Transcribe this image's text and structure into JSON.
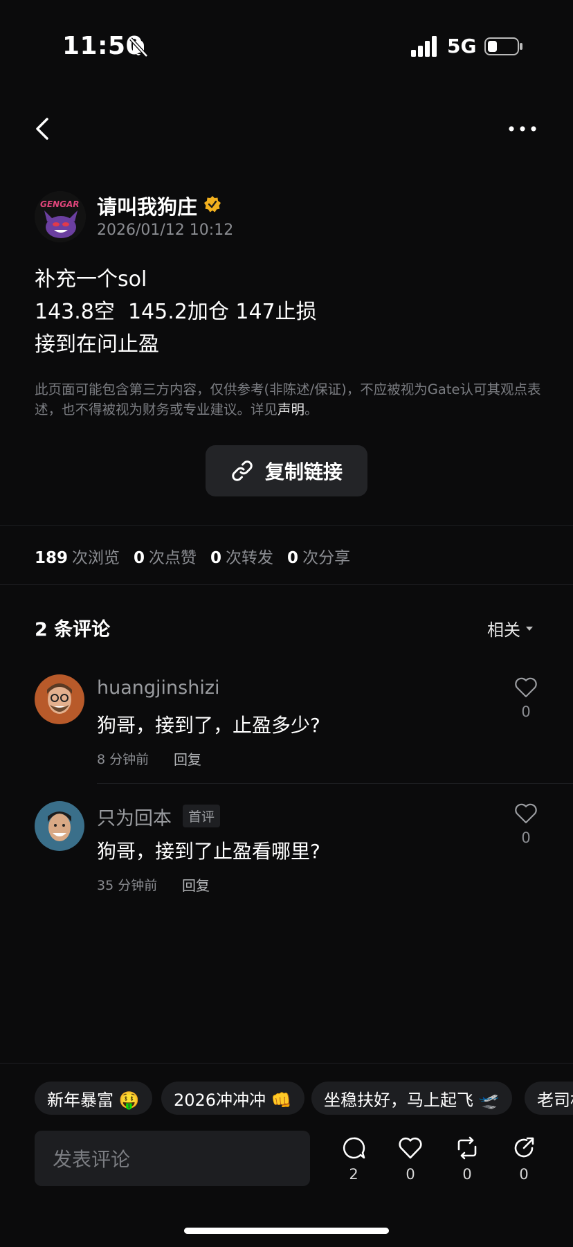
{
  "status_bar": {
    "time": "11:50",
    "network": "5G"
  },
  "post": {
    "author": "请叫我狗庄",
    "avatar_text": "GENGAR",
    "date": "2026/01/12 10:12",
    "lines": [
      "补充一个sol",
      "143.8空  145.2加仓 147止损",
      "接到在问止盈"
    ],
    "disclaimer": "此页面可能包含第三方内容，仅供参考(非陈述/保证)，不应被视为Gate认可其观点表述，也不得被视为财务或专业建议。详见",
    "disclaimer_link": "声明",
    "disclaimer_end": "。",
    "copy_label": "复制链接"
  },
  "stats": {
    "views": "189",
    "views_label": "次浏览",
    "likes": "0",
    "likes_label": "次点赞",
    "reposts": "0",
    "reposts_label": "次转发",
    "shares": "0",
    "shares_label": "次分享"
  },
  "comments_section": {
    "title": "2 条评论",
    "sort_label": "相关"
  },
  "comments": [
    {
      "user": "huangjinshizi",
      "text": "狗哥，接到了，止盈多少?",
      "time": "8 分钟前",
      "reply": "回复",
      "likes": "0"
    },
    {
      "user": "只为回本",
      "badge": "首评",
      "text": "狗哥，接到了止盈看哪里?",
      "time": "35 分钟前",
      "reply": "回复",
      "likes": "0"
    }
  ],
  "quick_replies": [
    "新年暴富 🤑",
    "2026冲冲冲 👊",
    "坐稳扶好，马上起飞 🛫",
    "老司机"
  ],
  "composer": {
    "placeholder": "发表评论",
    "comment_count": "2",
    "like_count": "0",
    "repost_count": "0",
    "share_count": "0"
  },
  "colors": {
    "background": "#0b0b0c",
    "verified": "#f2b01e",
    "muted": "#8b8d92",
    "chip_bg": "#1d1e21"
  },
  "icons": [
    "bell-slash-icon",
    "signal-icon",
    "battery-icon",
    "back-chevron-icon",
    "more-icon",
    "verified-badge-icon",
    "link-icon",
    "caret-down-icon",
    "heart-icon",
    "comment-icon",
    "repost-icon",
    "share-icon"
  ]
}
